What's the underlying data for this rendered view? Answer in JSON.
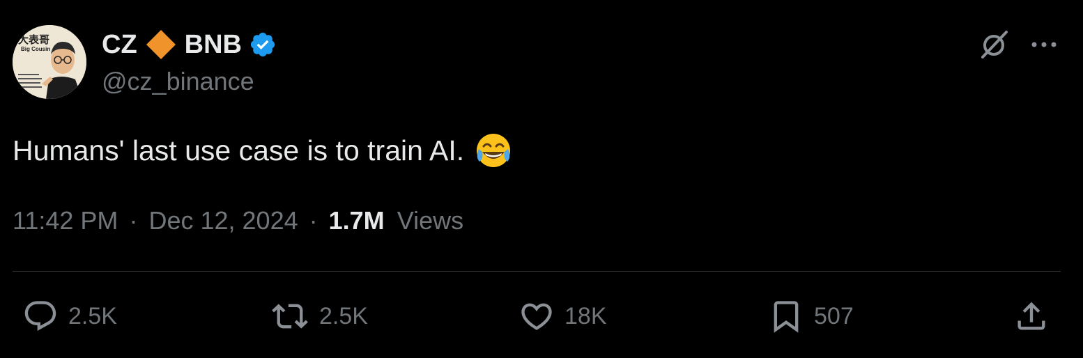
{
  "author": {
    "display_name": "CZ",
    "name_suffix": "BNB",
    "handle": "@cz_binance",
    "diamond_icon": "orange-diamond",
    "verified_icon": "blue-verified-badge",
    "avatar_caption": "Big Cousin",
    "avatar_chinese": "大表哥"
  },
  "tweet": {
    "text": "Humans' last use case is to train AI.",
    "emoji": "face-with-tears-of-joy"
  },
  "meta": {
    "time": "11:42 PM",
    "sep1": "·",
    "date": "Dec 12, 2024",
    "sep2": "·",
    "views_count": "1.7M",
    "views_label": "Views"
  },
  "actions": {
    "replies": "2.5K",
    "reposts": "2.5K",
    "likes": "18K",
    "bookmarks": "507"
  },
  "icons": {
    "grok": "grok-slash-icon",
    "more": "more-dots-icon",
    "reply": "reply-icon",
    "repost": "repost-icon",
    "like": "heart-icon",
    "bookmark": "bookmark-icon",
    "share": "share-icon"
  },
  "colors": {
    "background": "#000000",
    "text_primary": "#e7e9ea",
    "text_secondary": "#71767b",
    "divider": "#2f3336",
    "verified": "#1d9bf0",
    "diamond": "#f0932b"
  }
}
